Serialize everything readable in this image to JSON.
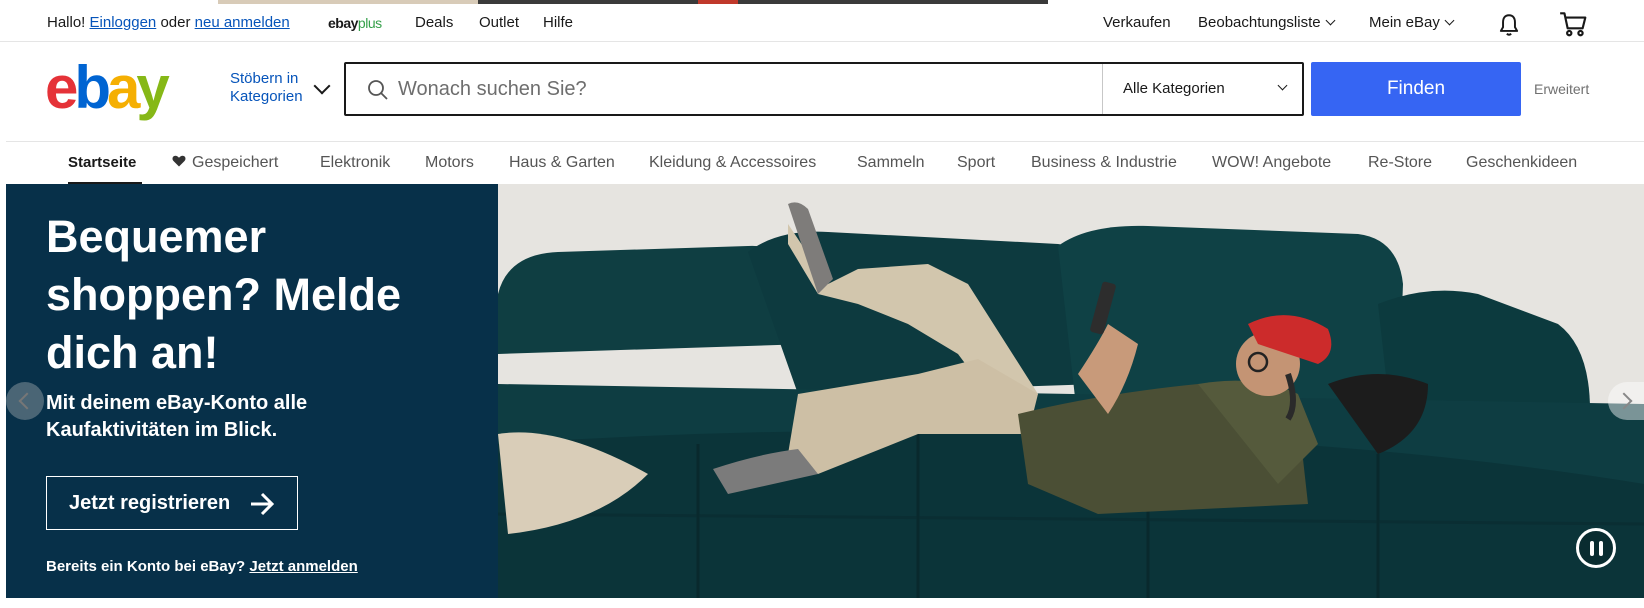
{
  "topbar": {
    "greeting": "Hallo!",
    "signin_label": "Einloggen",
    "or_text": "oder",
    "register_label": "neu anmelden",
    "ebayplus_brand": "ebay",
    "ebayplus_suffix": "plus",
    "deals_label": "Deals",
    "outlet_label": "Outlet",
    "help_label": "Hilfe",
    "sell_label": "Verkaufen",
    "watchlist_label": "Beobachtungsliste",
    "myebay_label": "Mein eBay",
    "icons": [
      "bell-icon",
      "cart-icon"
    ]
  },
  "header": {
    "logo_text": "ebay",
    "logo_colors": [
      "#e53238",
      "#0064d2",
      "#f5af02",
      "#86b817"
    ],
    "shop_by_category_line1": "Stöbern in",
    "shop_by_category_line2": "Kategorien",
    "search_placeholder": "Wonach suchen Sie?",
    "search_value": "",
    "category_selected": "Alle Kategorien",
    "find_button_label": "Finden",
    "advanced_label": "Erweitert",
    "accent_color": "#3665f3"
  },
  "nav": {
    "items": [
      "Startseite",
      "Gespeichert",
      "Elektronik",
      "Motors",
      "Haus & Garten",
      "Kleidung & Accessoires",
      "Sammeln",
      "Sport",
      "Business & Industrie",
      "WOW! Angebote",
      "Re-Store",
      "Geschenkideen"
    ],
    "active": "Startseite"
  },
  "hero": {
    "title": "Bequemer shoppen? Melde dich an!",
    "subtitle": "Mit deinem eBay-Konto alle Kaufaktivitäten im Blick.",
    "cta_label": "Jetzt registrieren",
    "login_prompt": "Bereits ein Konto bei eBay?",
    "login_link": "Jetzt anmelden",
    "panel_color": "#073049",
    "image_subject": "man-on-sofa-with-phone"
  }
}
